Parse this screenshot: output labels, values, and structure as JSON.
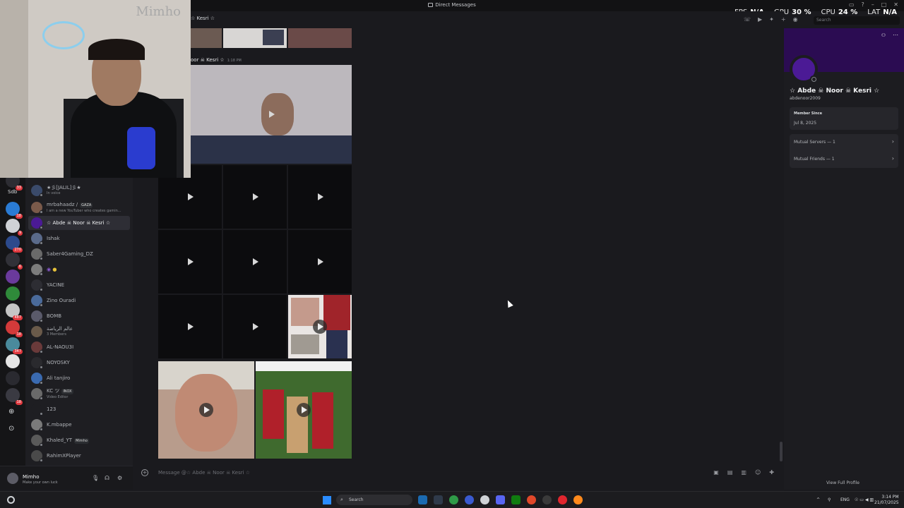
{
  "window": {
    "title": "Direct Messages"
  },
  "stats": [
    {
      "label": "FPS",
      "value": "N/A"
    },
    {
      "label": "GPU",
      "value": "30 %"
    },
    {
      "label": "CPU",
      "value": "24 %"
    },
    {
      "label": "LAT",
      "value": "N/A"
    }
  ],
  "header": {
    "channel_name": "☆ Kesri ☆",
    "search_placeholder": "Search"
  },
  "webcam": {
    "watermark": "Mimho"
  },
  "servers": {
    "label_text": "Sdb",
    "badges": [
      "33",
      "18",
      "9",
      "270",
      "6",
      "487",
      "18",
      "347",
      "18"
    ]
  },
  "dm_list": [
    {
      "name": "★彡[JALIL]彡★",
      "sub": "In voice",
      "tag": "",
      "selected": false
    },
    {
      "name": "mrbahaadz /",
      "sub": "I am a new YouTuber who creates gamin...",
      "tag": "GAZA",
      "selected": false
    },
    {
      "name": "☆ Abde ☠ Noor ☠ Kesri ☆",
      "sub": "",
      "tag": "",
      "selected": true
    },
    {
      "name": "Ishak",
      "sub": "",
      "tag": "",
      "selected": false
    },
    {
      "name": "Saber4Gaming_DZ",
      "sub": "",
      "tag": "",
      "selected": false
    },
    {
      "name": "",
      "sub": "",
      "tag": "",
      "selected": false
    },
    {
      "name": "YACINE",
      "sub": "",
      "tag": "",
      "selected": false
    },
    {
      "name": "Zino Ouradi",
      "sub": "",
      "tag": "",
      "selected": false
    },
    {
      "name": "BOMB",
      "sub": "",
      "tag": "",
      "selected": false
    },
    {
      "name": "عالم الرياضة",
      "sub": "3 Members",
      "tag": "",
      "selected": false
    },
    {
      "name": "AL-NAOU3I",
      "sub": "",
      "tag": "",
      "selected": false
    },
    {
      "name": "NOYOSKY",
      "sub": "",
      "tag": "",
      "selected": false
    },
    {
      "name": "Ali tanjiro",
      "sub": "",
      "tag": "",
      "selected": false
    },
    {
      "name": "KC ツ",
      "sub": "Video Editor",
      "tag": "INOX",
      "selected": false
    },
    {
      "name": "123",
      "sub": "",
      "tag": "",
      "selected": false
    },
    {
      "name": "K.mbappe",
      "sub": "",
      "tag": "",
      "selected": false
    },
    {
      "name": "Khaled_YT",
      "sub": "",
      "tag": "Mimho",
      "selected": false
    },
    {
      "name": "RahimXPlayer",
      "sub": "",
      "tag": "",
      "selected": false
    }
  ],
  "user_panel": {
    "name": "Mimho",
    "status": "Make your own luck"
  },
  "messages": [
    {
      "author": "oor ☠ Kesri ☆",
      "time": "1:18 PM"
    }
  ],
  "composer": {
    "placeholder": "Message @☆ Abde ☠ Noor ☠ Kesri ☆"
  },
  "profile": {
    "display_name": "☆ Abde ☠ Noor ☠ Kesri ☆",
    "username": "abdenoor2009",
    "member_since_label": "Member Since",
    "member_since_value": "Jul 8, 2025",
    "mutual_servers": "Mutual Servers — 1",
    "mutual_friends": "Mutual Friends — 1",
    "view_full_profile": "View Full Profile"
  },
  "taskbar": {
    "search_placeholder": "Search",
    "language": "ENG",
    "time": "3:14 PM",
    "date": "21/07/2025"
  },
  "colors": {
    "accent_purple": "#4b1a95",
    "banner": "#2b0c52",
    "badge_red": "#e0383e"
  }
}
